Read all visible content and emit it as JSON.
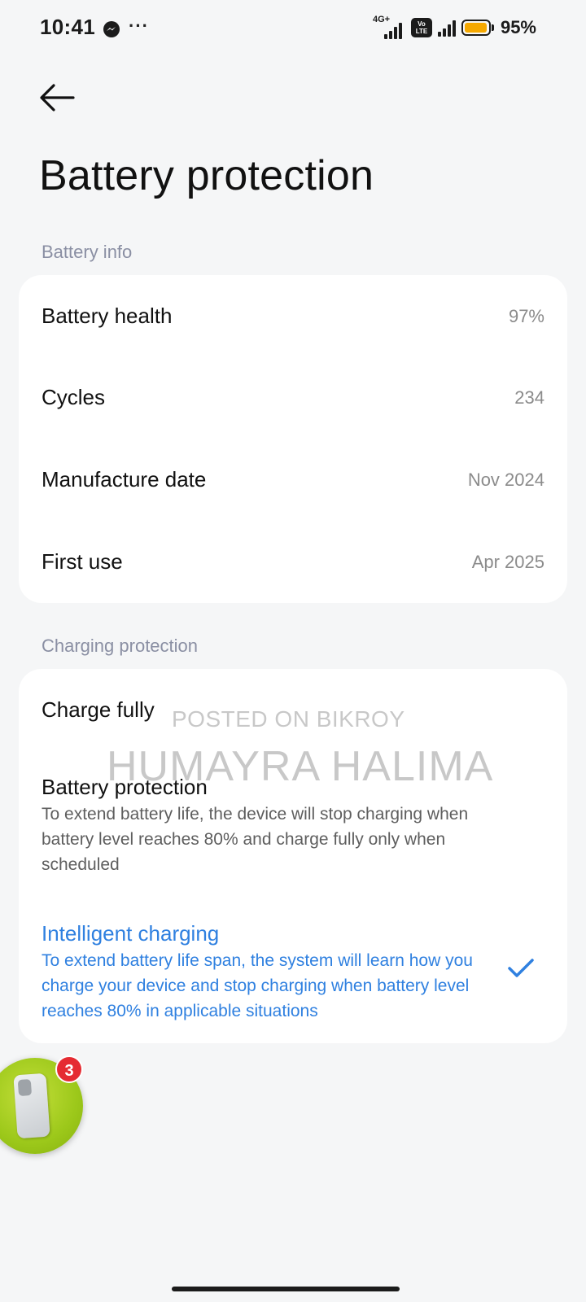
{
  "status_bar": {
    "time": "10:41",
    "more": "···",
    "network_type": "4G+",
    "volte": "Vo LTE",
    "battery_percent": "95%",
    "battery_level": 0.95,
    "battery_color": "#f5a800"
  },
  "header": {
    "back_icon": "arrow-left-icon",
    "title": "Battery protection"
  },
  "battery_info": {
    "section_label": "Battery info",
    "items": [
      {
        "label": "Battery health",
        "value": "97%"
      },
      {
        "label": "Cycles",
        "value": "234"
      },
      {
        "label": "Manufacture date",
        "value": "Nov 2024"
      },
      {
        "label": "First use",
        "value": "Apr 2025"
      }
    ]
  },
  "charging_protection": {
    "section_label": "Charging protection",
    "options": [
      {
        "title": "Charge fully",
        "description": "",
        "selected": false
      },
      {
        "title": "Battery protection",
        "description": "To extend battery life, the device will stop charging when battery level reaches 80% and charge fully only when scheduled",
        "selected": false
      },
      {
        "title": "Intelligent charging",
        "description": "To extend battery life span, the system will learn how you charge your device and stop charging when battery level reaches 80% in applicable situations",
        "selected": true
      }
    ],
    "accent_color": "#2f80e0"
  },
  "watermark": {
    "line1": "POSTED ON BIKROY",
    "line2": "HUMAYRA HALIMA"
  },
  "chat_bubble": {
    "badge_count": "3"
  }
}
